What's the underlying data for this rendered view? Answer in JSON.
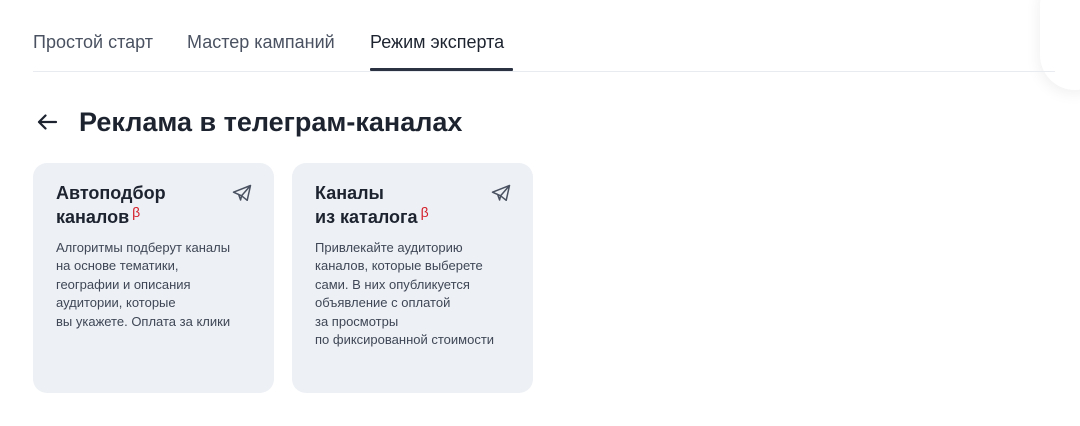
{
  "tabs": [
    {
      "label": "Простой старт",
      "active": false
    },
    {
      "label": "Мастер кампаний",
      "active": false
    },
    {
      "label": "Режим эксперта",
      "active": true
    }
  ],
  "header": {
    "back_icon": "arrow-left-icon",
    "title": "Реклама в телеграм-каналах"
  },
  "cards": [
    {
      "title_lines": [
        "Автоподбор",
        "каналов"
      ],
      "badge": "β",
      "icon": "telegram-plane-icon",
      "description_lines": [
        "Алгоритмы подберут каналы",
        "на основе тематики,",
        "географии и описания",
        "аудитории, которые",
        "вы укажете. Оплата за клики"
      ]
    },
    {
      "title_lines": [
        "Каналы",
        "из каталога"
      ],
      "badge": "β",
      "icon": "telegram-plane-icon",
      "description_lines": [
        "Привлекайте аудиторию",
        "каналов, которые выберете",
        "сами. В них опубликуется",
        "объявление с оплатой",
        "за просмотры",
        "по фиксированной стоимости"
      ]
    }
  ],
  "colors": {
    "text_primary": "#1d2430",
    "text_secondary": "#4a5261",
    "card_background": "#edf0f5",
    "beta_badge": "#d4202a",
    "active_underline": "#2b3342"
  }
}
